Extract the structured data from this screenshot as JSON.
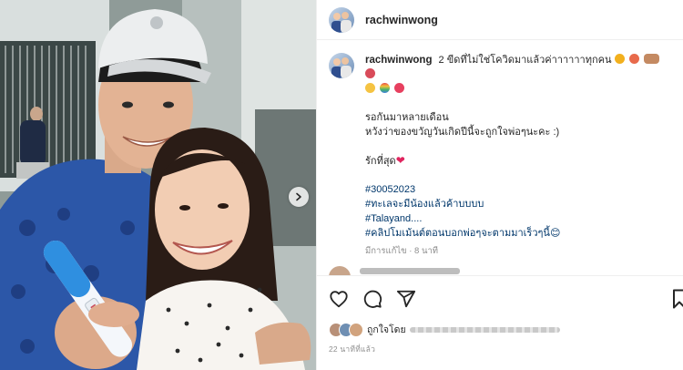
{
  "post": {
    "username": "rachwinwong",
    "caption": {
      "line1": "2 ขีดที่ไม่ใช่โควิดมาแล้วค่าาาาาาทุกคน",
      "line2": "รอกันมาหลายเดือน",
      "line3": "หวังว่าของขวัญวันเกิดปีนี้จะถูกใจพ่อๆนะคะ :)",
      "line4": "รักที่สุด",
      "hashtags": [
        "#30052023",
        "#ทะเลจะมีน้องแล้วค้าบบบบ",
        "#Talayand....",
        "#คลิปโมเม้นต์ตอนบอกพ่อๆจะตามมาเร็วๆนี้😊"
      ],
      "edited_time": "มีการแก้ไข · 8 นาที"
    },
    "liked_by_label": "ถูกใจโดย",
    "post_time": "22 นาทีที่แล้ว"
  },
  "icons": {
    "like": "heart-outline-icon",
    "comment": "comment-icon",
    "share": "share-paper-plane-icon",
    "save": "bookmark-icon",
    "carousel": "chevron-right-icon"
  },
  "colors": {
    "hashtag": "#00376b",
    "heart": "#e0245e",
    "meta": "#8e8e8e"
  }
}
